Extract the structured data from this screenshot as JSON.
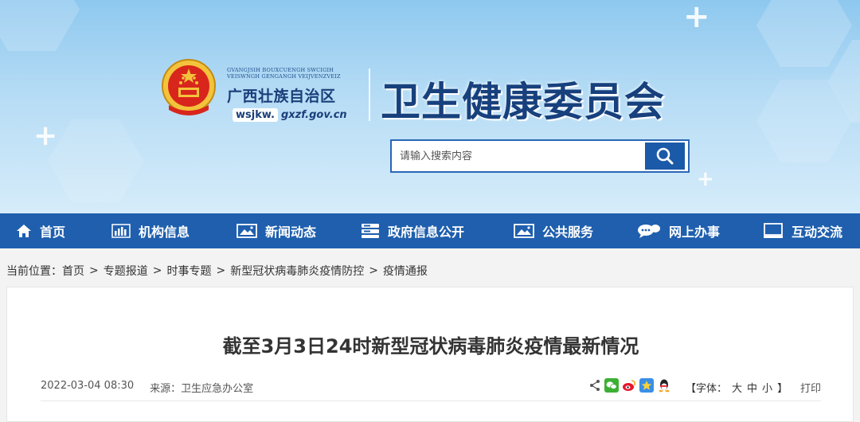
{
  "header": {
    "gov_small_text": "GVANGJSIH BOUXCUENGH SWCIGIH VEISWNGH GENGANGH VEIJVENZVEIZ",
    "gov_name": "广西壮族自治区",
    "domain_badge": "wsjkw.",
    "domain_rest": "gxzf.gov.cn",
    "dept_title": "卫生健康委员会",
    "icons": [
      "national-emblem-icon",
      "search-icon"
    ]
  },
  "search": {
    "placeholder": "请输入搜索内容"
  },
  "nav": {
    "items": [
      {
        "label": "首页",
        "icon": "home-icon"
      },
      {
        "label": "机构信息",
        "icon": "bar-chart-icon"
      },
      {
        "label": "新闻动态",
        "icon": "image-icon"
      },
      {
        "label": "政府信息公开",
        "icon": "server-icon"
      },
      {
        "label": "公共服务",
        "icon": "picture-icon"
      },
      {
        "label": "网上办事",
        "icon": "chat-icon"
      },
      {
        "label": "互动交流",
        "icon": "monitor-icon"
      }
    ]
  },
  "breadcrumb": {
    "prefix": "当前位置：",
    "items": [
      "首页",
      "专题报道",
      "时事专题",
      "新型冠状病毒肺炎疫情防控",
      "疫情通报"
    ],
    "separator": ">"
  },
  "article": {
    "title": "截至3月3日24时新型冠状病毒肺炎疫情最新情况",
    "datetime": "2022-03-04 08:30",
    "source": "来源：卫生应急办公室",
    "font_size_label_open": "【字体：",
    "font_sizes": [
      "大",
      "中",
      "小"
    ],
    "font_size_label_close": "】",
    "print_label": "打印",
    "share_icons": [
      "share-icon",
      "wechat-icon",
      "weibo-icon",
      "qzone-icon",
      "qq-icon"
    ]
  },
  "colors": {
    "nav_bg": "#1f5fae",
    "title_blue": "#17407d",
    "search_btn": "#1b5aa8"
  }
}
